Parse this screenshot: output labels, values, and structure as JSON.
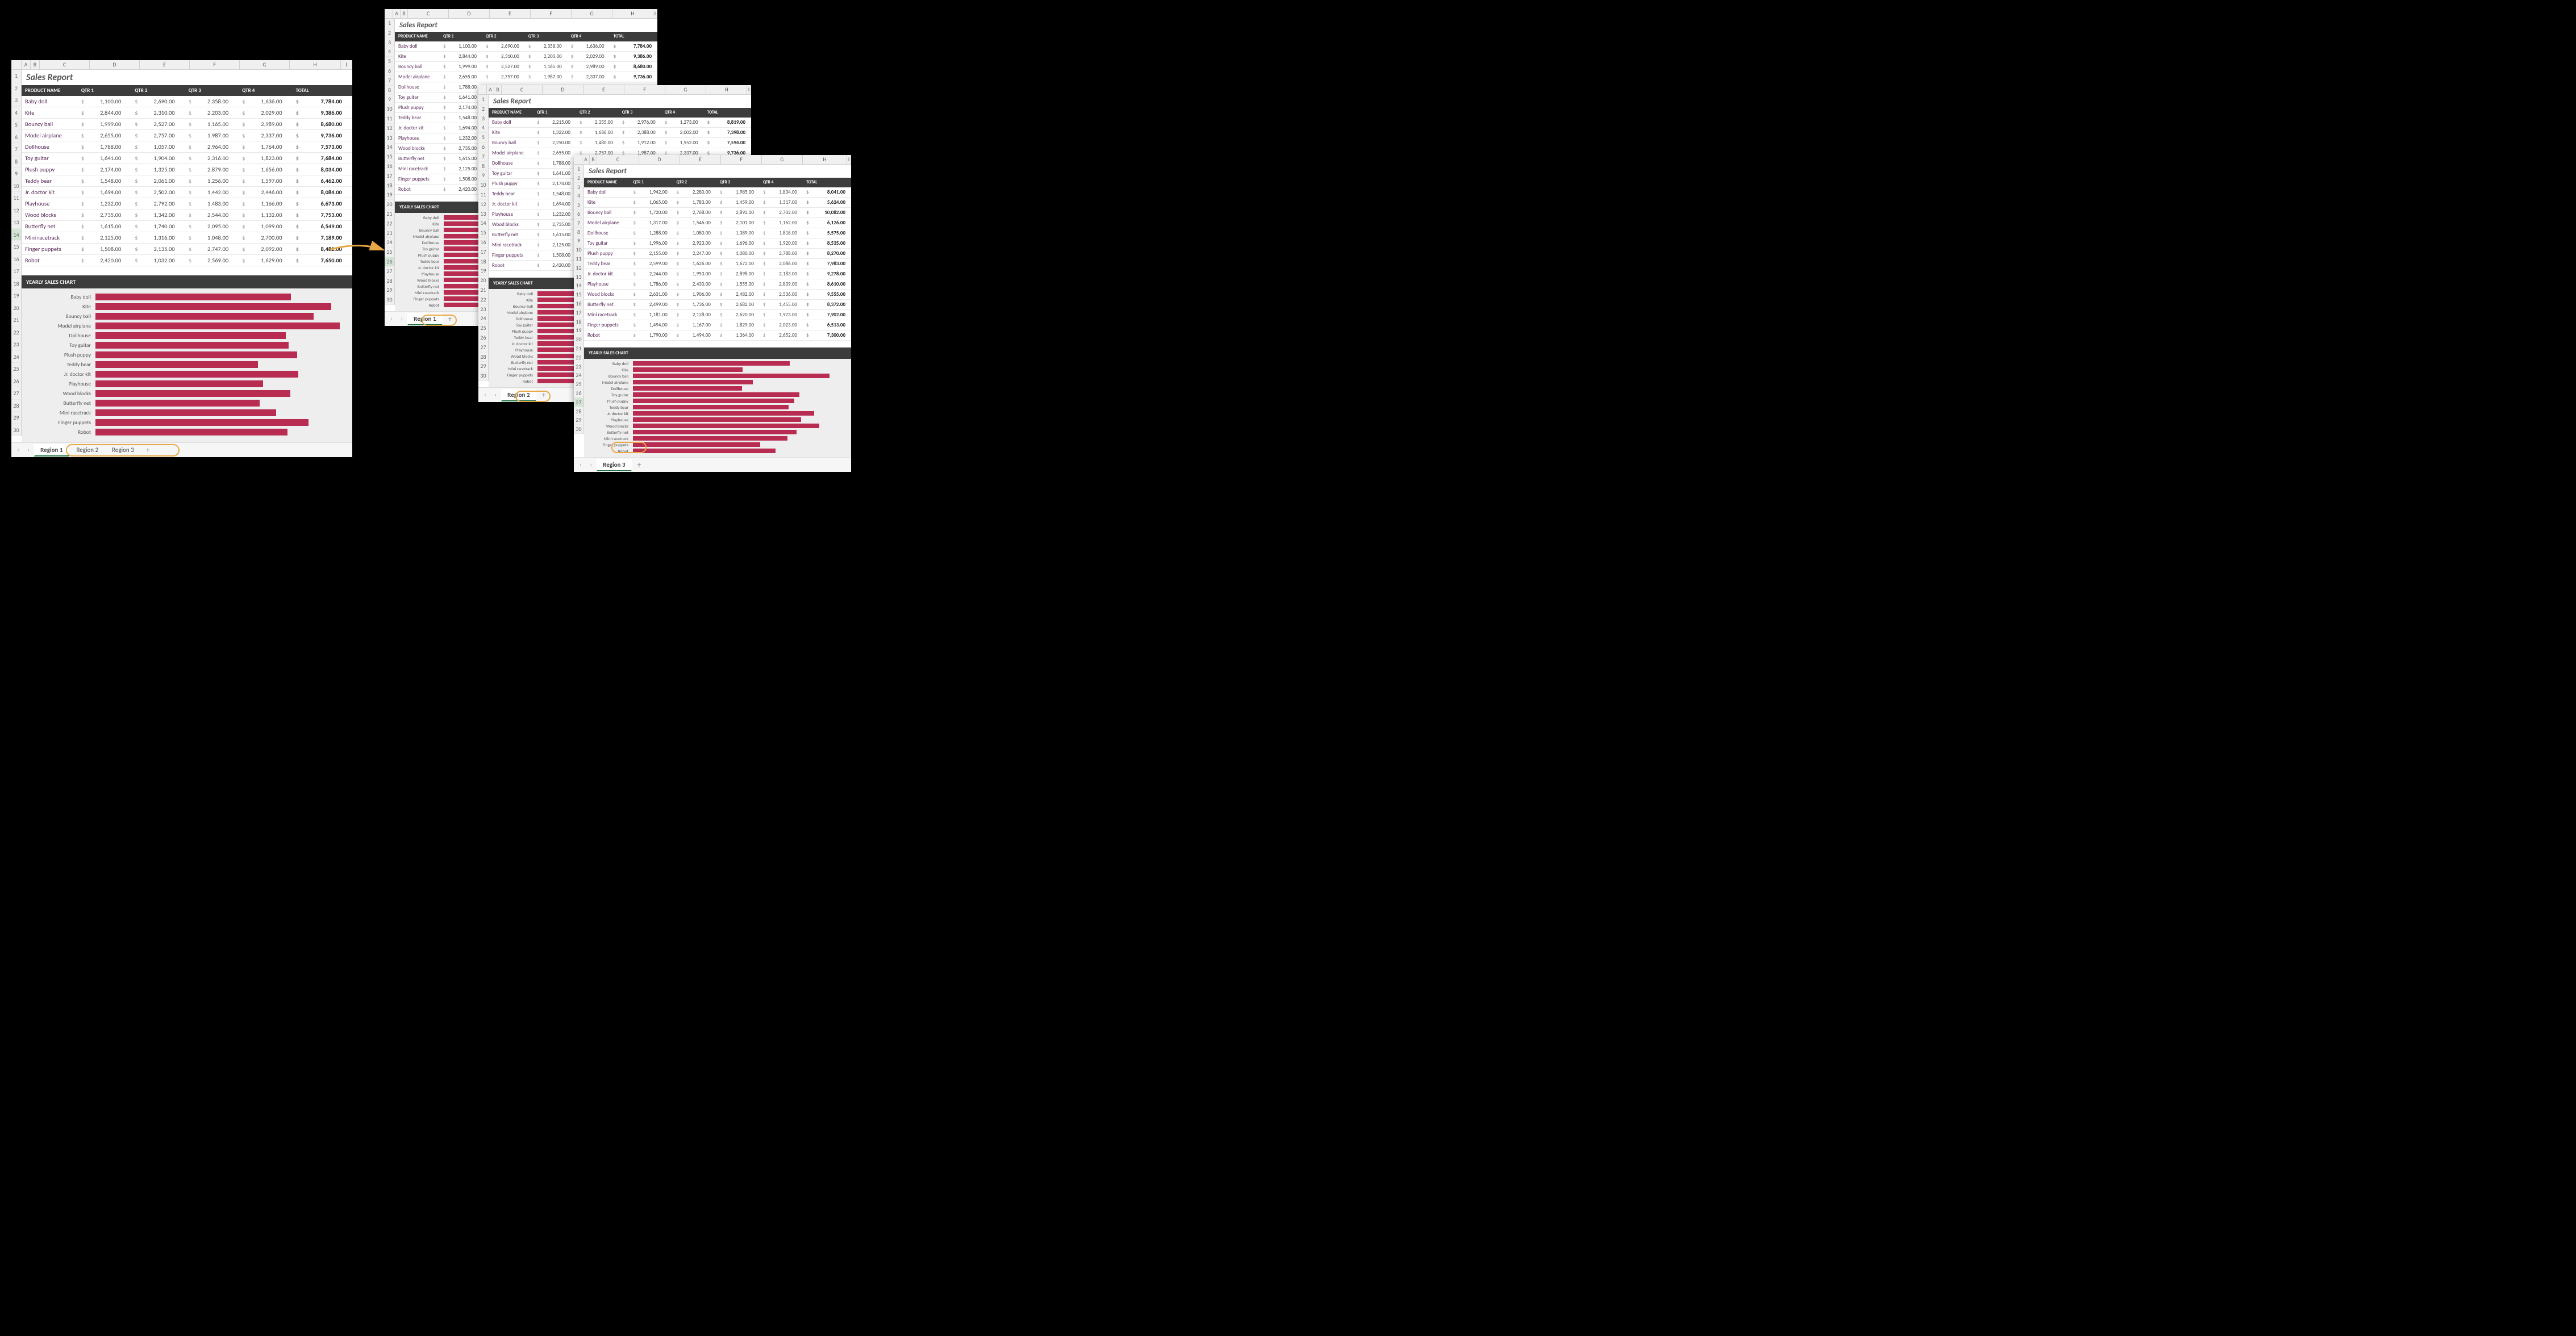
{
  "title": "Sales Report",
  "columns": [
    "PRODUCT NAME",
    "QTR 1",
    "QTR 2",
    "QTR 3",
    "QTR 4",
    "TOTAL"
  ],
  "col_letters_main": [
    "A",
    "B",
    "C",
    "D",
    "E",
    "F",
    "G",
    "H",
    "I"
  ],
  "products": [
    "Baby doll",
    "Kite",
    "Bouncy ball",
    "Model airplane",
    "Dollhouse",
    "Toy guitar",
    "Plush puppy",
    "Teddy bear",
    "Jr. doctor kit",
    "Playhouse",
    "Wood blocks",
    "Butterfly net",
    "Mini racetrack",
    "Finger puppets",
    "Robot"
  ],
  "tabs_main": [
    "Region 1",
    "Region 2",
    "Region 3"
  ],
  "tab_r1": "Region 1",
  "tab_r2": "Region 2",
  "tab_r3": "Region 3",
  "chart_title": "YEARLY SALES CHART",
  "cur": "$",
  "plus": "+",
  "chevL": "‹",
  "chevR": "›",
  "region1": {
    "rows": [
      [
        "1,100.00",
        "2,690.00",
        "2,358.00",
        "1,636.00",
        "7,784.00"
      ],
      [
        "2,844.00",
        "2,310.00",
        "2,203.00",
        "2,029.00",
        "9,386.00"
      ],
      [
        "1,999.00",
        "2,527.00",
        "1,165.00",
        "2,989.00",
        "8,680.00"
      ],
      [
        "2,655.00",
        "2,757.00",
        "1,987.00",
        "2,337.00",
        "9,736.00"
      ],
      [
        "1,788.00",
        "1,057.00",
        "2,964.00",
        "1,764.00",
        "7,573.00"
      ],
      [
        "1,641.00",
        "1,904.00",
        "2,316.00",
        "1,823.00",
        "7,684.00"
      ],
      [
        "2,174.00",
        "1,325.00",
        "2,879.00",
        "1,656.00",
        "8,034.00"
      ],
      [
        "1,548.00",
        "2,061.00",
        "1,256.00",
        "1,597.00",
        "6,462.00"
      ],
      [
        "1,694.00",
        "2,502.00",
        "1,442.00",
        "2,446.00",
        "8,084.00"
      ],
      [
        "1,232.00",
        "2,792.00",
        "1,483.00",
        "1,166.00",
        "6,673.00"
      ],
      [
        "2,735.00",
        "1,342.00",
        "2,544.00",
        "1,132.00",
        "7,753.00"
      ],
      [
        "1,615.00",
        "1,740.00",
        "2,095.00",
        "1,099.00",
        "6,549.00"
      ],
      [
        "2,125.00",
        "1,316.00",
        "1,048.00",
        "2,700.00",
        "7,189.00"
      ],
      [
        "1,508.00",
        "2,135.00",
        "2,747.00",
        "2,092.00",
        "8,482.00"
      ],
      [
        "2,420.00",
        "1,032.00",
        "2,569.00",
        "1,629.00",
        "7,650.00"
      ]
    ]
  },
  "region2": {
    "rows": [
      [
        "2,215.00",
        "2,355.00",
        "2,976.00",
        "1,273.00",
        "8,819.00"
      ],
      [
        "1,322.00",
        "1,686.00",
        "2,388.00",
        "2,002.00",
        "7,398.00"
      ],
      [
        "2,250.00",
        "1,480.00",
        "1,912.00",
        "1,952.00",
        "7,594.00"
      ]
    ]
  },
  "region3": {
    "rows": [
      [
        "1,942.00",
        "2,280.00",
        "1,985.00",
        "1,834.00",
        "8,041.00"
      ],
      [
        "1,065.00",
        "1,783.00",
        "1,459.00",
        "1,317.00",
        "5,624.00"
      ],
      [
        "1,720.00",
        "2,768.00",
        "2,892.00",
        "2,702.00",
        "10,082.00"
      ],
      [
        "1,317.00",
        "1,546.00",
        "2,101.00",
        "1,162.00",
        "6,126.00"
      ],
      [
        "1,288.00",
        "1,080.00",
        "1,389.00",
        "1,818.00",
        "5,575.00"
      ],
      [
        "1,996.00",
        "2,923.00",
        "1,696.00",
        "1,920.00",
        "8,535.00"
      ],
      [
        "2,155.00",
        "2,247.00",
        "1,080.00",
        "2,788.00",
        "8,270.00"
      ],
      [
        "2,599.00",
        "1,626.00",
        "1,672.00",
        "2,086.00",
        "7,983.00"
      ],
      [
        "2,244.00",
        "1,953.00",
        "2,898.00",
        "2,183.00",
        "9,278.00"
      ],
      [
        "1,786.00",
        "2,430.00",
        "1,555.00",
        "2,839.00",
        "8,610.00"
      ],
      [
        "2,631.00",
        "1,906.00",
        "2,482.00",
        "2,536.00",
        "9,555.00"
      ],
      [
        "2,499.00",
        "1,736.00",
        "2,682.00",
        "1,455.00",
        "8,372.00"
      ],
      [
        "1,181.00",
        "2,128.00",
        "2,620.00",
        "1,973.00",
        "7,902.00"
      ],
      [
        "1,494.00",
        "1,167.00",
        "1,829.00",
        "2,023.00",
        "6,513.00"
      ],
      [
        "1,790.00",
        "1,494.00",
        "1,364.00",
        "2,652.00",
        "7,300.00"
      ]
    ]
  },
  "chart_data": [
    {
      "type": "bar",
      "title": "YEARLY SALES CHART",
      "region": "Region 1",
      "categories": [
        "Baby doll",
        "Kite",
        "Bouncy ball",
        "Model airplane",
        "Dollhouse",
        "Toy guitar",
        "Plush puppy",
        "Teddy bear",
        "Jr. doctor kit",
        "Playhouse",
        "Wood blocks",
        "Butterfly net",
        "Mini racetrack",
        "Finger puppets",
        "Robot"
      ],
      "values": [
        7784,
        9386,
        8680,
        9736,
        7573,
        7684,
        8034,
        6462,
        8084,
        6673,
        7753,
        6549,
        7189,
        8482,
        7650
      ],
      "xlabel": "",
      "ylabel": "",
      "xlim": [
        0,
        10000
      ]
    },
    {
      "type": "bar",
      "title": "YEARLY SALES CHART",
      "region": "Region 3",
      "categories": [
        "Baby doll",
        "Kite",
        "Bouncy ball",
        "Model airplane",
        "Dollhouse",
        "Toy guitar",
        "Plush puppy",
        "Teddy bear",
        "Jr. doctor kit",
        "Playhouse",
        "Wood blocks",
        "Butterfly net",
        "Mini racetrack",
        "Finger puppets",
        "Robot"
      ],
      "values": [
        8041,
        5624,
        10082,
        6126,
        5575,
        8535,
        8270,
        7983,
        9278,
        8610,
        9555,
        8372,
        7902,
        6513,
        7300
      ],
      "xlabel": "",
      "ylabel": "",
      "xlim": [
        0,
        11000
      ]
    }
  ]
}
